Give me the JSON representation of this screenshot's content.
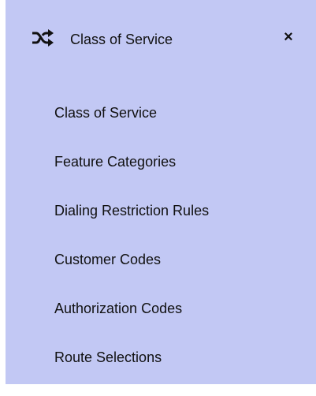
{
  "panel": {
    "title": "Class of Service",
    "header_icon": "shuffle-icon",
    "close_icon": "close-icon",
    "close_label": "×",
    "background": "#c2c8f4"
  },
  "menu": {
    "items": [
      {
        "label": "Class of Service"
      },
      {
        "label": "Feature Categories"
      },
      {
        "label": "Dialing Restriction Rules"
      },
      {
        "label": "Customer Codes"
      },
      {
        "label": "Authorization Codes"
      },
      {
        "label": "Route Selections"
      }
    ]
  }
}
